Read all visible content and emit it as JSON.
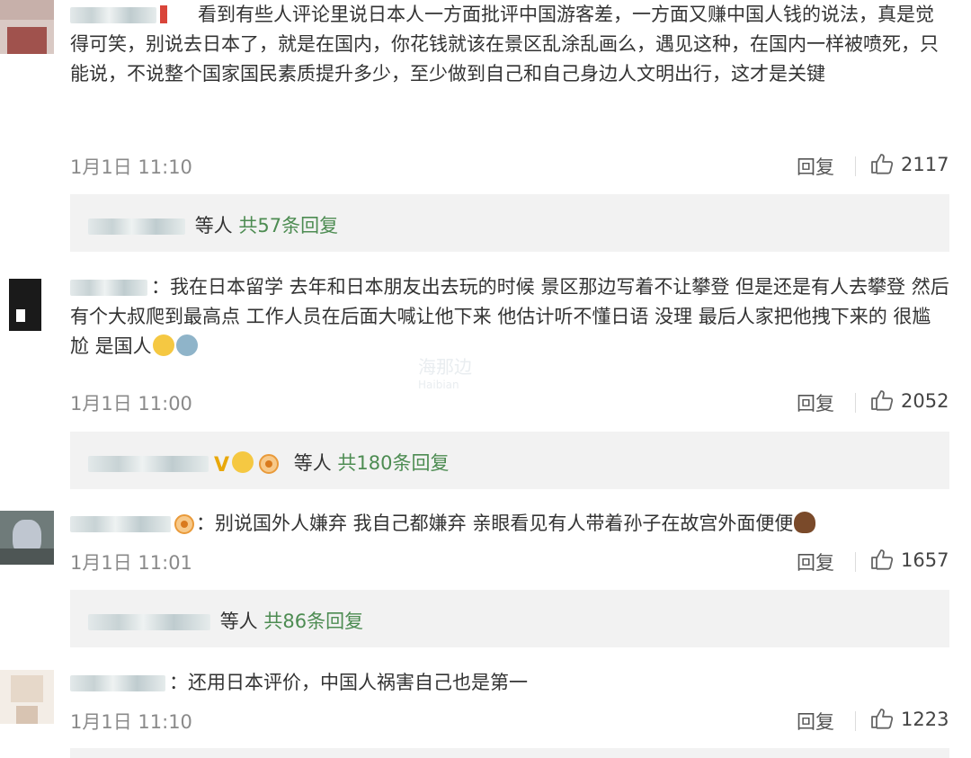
{
  "comments": [
    {
      "text": "看到有些人评论里说日本人一方面批评中国游客差，一方面又赚中国人钱的说法，真是觉得可笑，别说去日本了，就是在国内，你花钱就该在景区乱涂乱画么，遇见这种，在国内一样被喷死，只能说，不说整个国家国民素质提升多少，至少做到自己和自己身边人文明出行，这才是关键",
      "date": "1月1日 11:10",
      "reply_label": "回复",
      "likes": "2117",
      "thread": {
        "suffix": "等人",
        "count_label": "共57条回复"
      }
    },
    {
      "text": "：我在日本留学 去年和日本朋友出去玩的时候 景区那边写着不让攀登 但是还是有人去攀登 然后有个大叔爬到最高点 工作人员在后面大喊让他下来 他估计听不懂日语 没理 最后人家把他拽下来的 很尴尬 是国人",
      "emoji_names": [
        "laughing-crying-emoji",
        "child-emoji"
      ],
      "date": "1月1日 11:00",
      "reply_label": "回复",
      "likes": "2052",
      "thread": {
        "suffix": "等人",
        "count_label": "共180条回复",
        "icons": [
          "v-badge",
          "heart-eyes-emoji",
          "member-badge"
        ]
      }
    },
    {
      "text": "：别说国外人嫌弃 我自己都嫌弃 亲眼看见有人带着孙子在故宫外面便便",
      "emoji_names": [
        "member-badge",
        "poop-emoji"
      ],
      "date": "1月1日 11:01",
      "reply_label": "回复",
      "likes": "1657",
      "thread": {
        "suffix": "等人",
        "count_label": "共86条回复"
      }
    },
    {
      "text": "：还用日本评价，中国人祸害自己也是第一",
      "date": "1月1日 11:10",
      "reply_label": "回复",
      "likes": "1223"
    }
  ],
  "watermark": {
    "text": "海那边",
    "sub": "Haibian"
  },
  "colors": {
    "reply_count": "#4d8c52",
    "reply_box": "#f2f2f2",
    "meta": "#8a8a8a"
  }
}
